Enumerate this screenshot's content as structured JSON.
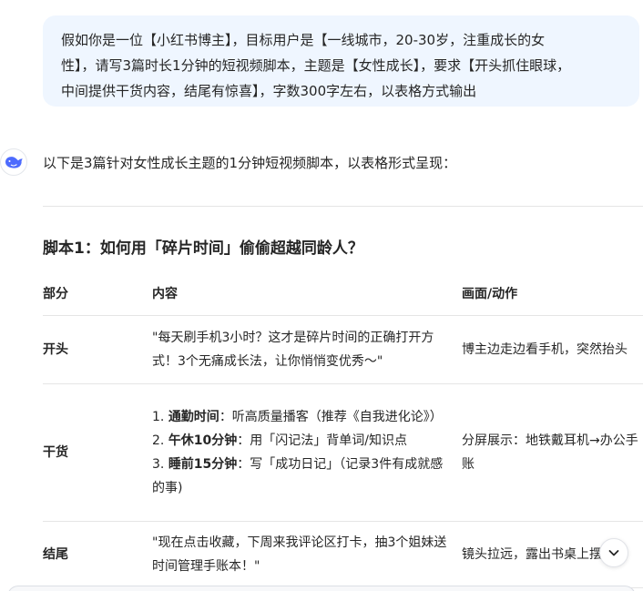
{
  "user_message": {
    "line1": "假如你是一位【小红书博主】，目标用户是【一线城市，20-30岁，注重成长的女",
    "line2": "性】，请写3篇时长1分钟的短视频脚本，主题是【女性成长】，要求【开头抓住眼球，",
    "line3": "中间提供干货内容，结尾有惊喜】，字数300字左右，以表格方式输出"
  },
  "assistant": {
    "avatar_icon": "whale-logo-icon",
    "brand_color": "#4d6bfe",
    "intro": "以下是3篇针对女性成长主题的1分钟短视频脚本，以表格形式呈现：",
    "script1": {
      "title": "脚本1：如何用「碎片时间」偷偷超越同龄人？",
      "headers": [
        "部分",
        "内容",
        "画面/动作"
      ],
      "rows": [
        {
          "part": "开头",
          "content": "\"每天刷手机3小时？这才是碎片时间的正确打开方式！3个无痛成长法，让你悄悄变优秀～\"",
          "visual": "博主边走边看手机，突然抬头"
        },
        {
          "part": "干货",
          "items": [
            {
              "num": "1. ",
              "label": "通勤时间",
              "text": "：听高质量播客（推荐《自我进化论》）"
            },
            {
              "num": "2. ",
              "label": "午休10分钟",
              "text": "：用「闪记法」背单词/知识点"
            },
            {
              "num": "3. ",
              "label": "睡前15分钟",
              "text": "：写「成功日记」（记录3件有成就感的事)"
            }
          ],
          "visual": "分屏展示：地铁戴耳机→办公手账"
        },
        {
          "part": "结尾",
          "content": "\"现在点击收藏，下周来我评论区打卡，抽3个姐妹送时间管理手账本！\"",
          "visual": "镜头拉远，露出书桌上摆着手"
        }
      ]
    }
  },
  "controls": {
    "scroll_down_icon": "chevron-down-icon"
  }
}
